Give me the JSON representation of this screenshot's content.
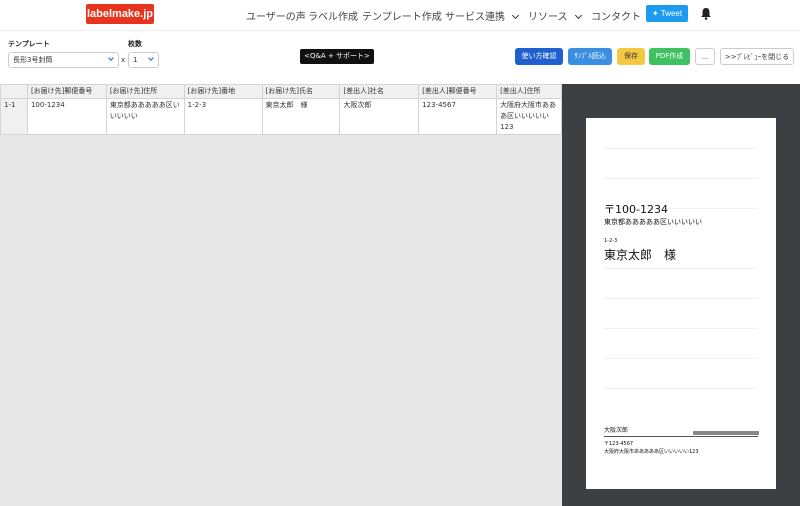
{
  "navbar": {
    "logo": "labelmake.jp",
    "links": [
      "ユーザーの声",
      "ラベル作成",
      "テンプレート作成",
      "サービス連携",
      "リソース",
      "コンタクト"
    ],
    "tweet": "Tweet",
    "bell_icon": "bell-icon"
  },
  "toolbar": {
    "template_label": "テンプレート",
    "template_value": "長形3号封筒",
    "count_label": "枚数",
    "times": "x",
    "count_value": "1",
    "qa_label": "<Q&A + サポート>",
    "buttons": {
      "usage": "使い方確認",
      "csv": "ｻﾝﾌﾟﾙ読込",
      "save": "保存",
      "pdf": "PDF作成",
      "more": "...",
      "close_preview": ">>ﾌﾟﾚﾋﾞｭｰを閉じる"
    },
    "colors": {
      "usage": "#1f5fce",
      "csv": "#3a8fe0",
      "save": "#f5c842",
      "pdf": "#3fc061"
    }
  },
  "sheet": {
    "columns": [
      "[お届け先]郵便番号",
      "[お届け先]住所",
      "[お届け先]番地",
      "[お届け先]氏名",
      "[差出人]社名",
      "[差出人]郵便番号",
      "[差出人]住所"
    ],
    "rows": [
      {
        "id": "1-1",
        "cells": [
          "100-1234",
          "東京都あああああ区いいいいい",
          "1-2-3",
          "東京太郎　様",
          "大阪次郎",
          "123-4567",
          "大阪府大阪市あああ区いいいいい123"
        ]
      }
    ]
  },
  "preview": {
    "zip": "〒100-1234",
    "address": "東京都あああああ区いいいいい",
    "banchi": "1-2-3",
    "name": "東京太郎　様",
    "sender_name": "大阪次郎",
    "sender_zip": "〒123-4567",
    "sender_address": "大阪府大阪市あああああ区いいいいい123"
  }
}
